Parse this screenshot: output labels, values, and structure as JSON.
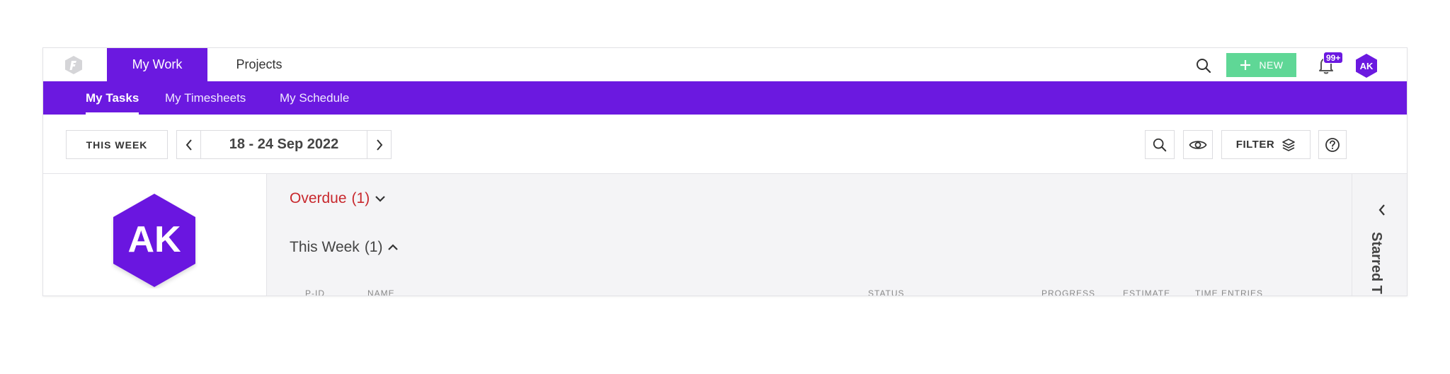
{
  "colors": {
    "brand": "#6b19e0",
    "new_button": "#5fd796",
    "overdue": "#c8282d"
  },
  "topbar": {
    "logo_icon": "app-logo-icon",
    "tabs": [
      {
        "label": "My Work",
        "active": true
      },
      {
        "label": "Projects",
        "active": false
      }
    ],
    "new_button_label": "NEW",
    "notification_badge": "99+",
    "avatar_initials": "AK"
  },
  "subnav": {
    "tabs": [
      {
        "label": "My Tasks",
        "active": true
      },
      {
        "label": "My Timesheets",
        "active": false
      },
      {
        "label": "My Schedule",
        "active": false
      }
    ]
  },
  "toolbar": {
    "this_week_label": "THIS WEEK",
    "date_range": "18 - 24 Sep 2022",
    "filter_label": "FILTER"
  },
  "profile": {
    "initials": "AK"
  },
  "sections": {
    "overdue": {
      "label": "Overdue",
      "count": "(1)"
    },
    "this_week": {
      "label": "This Week",
      "count": "(1)"
    }
  },
  "table": {
    "columns": [
      "P-ID",
      "NAME",
      "STATUS",
      "PROGRESS",
      "ESTIMATE",
      "TIME ENTRIES"
    ]
  },
  "right_panel": {
    "title": "Starred T"
  }
}
